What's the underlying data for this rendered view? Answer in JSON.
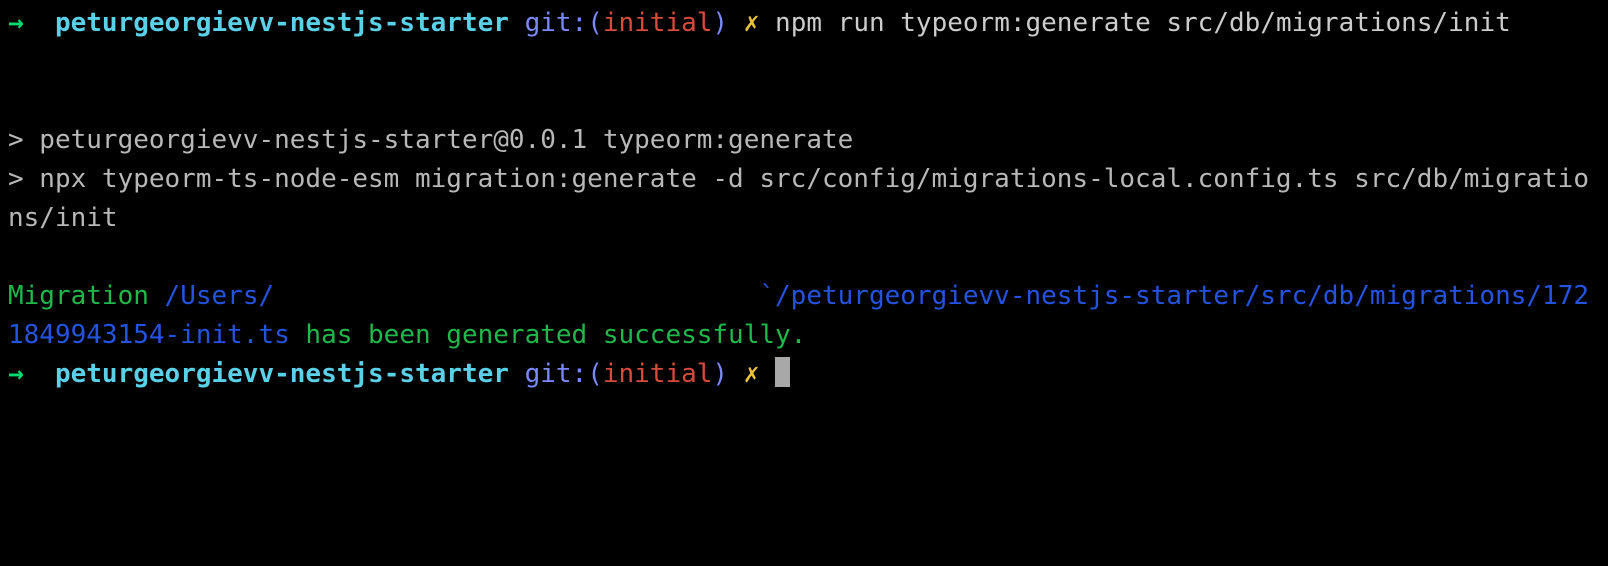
{
  "prompt1": {
    "arrow": "→  ",
    "dir": "peturgeorgievv-nestjs-starter",
    "git_label": " git:(",
    "git_branch": "initial",
    "git_close": ")",
    "dirty": " ✗ ",
    "command": "npm run typeorm:generate src/db/migrations/init"
  },
  "blank1": " ",
  "blank2": " ",
  "output": {
    "line1": "> peturgeorgievv-nestjs-starter@0.0.1 typeorm:generate",
    "line2": "> npx typeorm-ts-node-esm migration:generate -d src/config/migrations-local.config.ts src/db/migrations/init"
  },
  "blank3": " ",
  "result": {
    "prefix": "Migration ",
    "path_part1": "/Users/",
    "path_hidden": "                               `",
    "path_part2": "/peturgeorgievv-nestjs-starter/src/db/migrations/1721849943154-init.ts",
    "suffix": " has been generated successfully."
  },
  "prompt2": {
    "arrow": "→  ",
    "dir": "peturgeorgievv-nestjs-starter",
    "git_label": " git:(",
    "git_branch": "initial",
    "git_close": ")",
    "dirty": " ✗ "
  }
}
